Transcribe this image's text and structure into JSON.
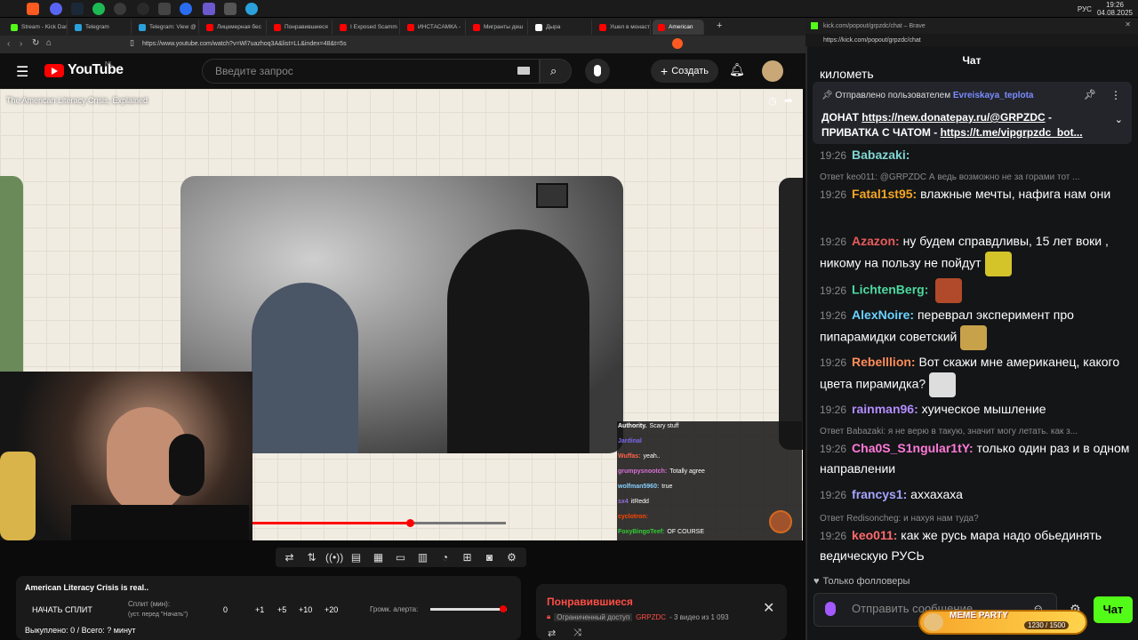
{
  "os": {
    "time": "19:26",
    "date": "04.08.2025",
    "lang": "РУС"
  },
  "browser": {
    "tabs": [
      {
        "label": "Stream - Kick Das",
        "color": "#53fc18"
      },
      {
        "label": "Telegram",
        "color": "#2aa1da"
      },
      {
        "label": "Telegram: View @",
        "color": "#2aa1da"
      },
      {
        "label": "Лицемерная бес",
        "color": "#ff0000"
      },
      {
        "label": "Понравившиеся",
        "color": "#ff0000"
      },
      {
        "label": "I Exposed Scamm",
        "color": "#ff0000"
      },
      {
        "label": "ИНСТАСАМКА -",
        "color": "#ff0000"
      },
      {
        "label": "Мигранты деш",
        "color": "#ff0000"
      },
      {
        "label": "Дыра",
        "color": "#ffffff"
      },
      {
        "label": "Ушел в монаст",
        "color": "#ff0000"
      },
      {
        "label": "American",
        "color": "#ff0000",
        "active": true
      }
    ],
    "url": "https://www.youtube.com/watch?v=Wl7uazhoq3A&list=LL&index=48&t=5s"
  },
  "youtube": {
    "logo": "YouTube",
    "region": "NL",
    "search_placeholder": "Введите запрос",
    "create_label": "Создать",
    "video_title": "The American Literacy Crisis, Explained",
    "progress": 0.62
  },
  "video_chat": [
    {
      "user": "Authority.",
      "text": "Scary stuff",
      "color": "#ffffff"
    },
    {
      "user": "Jardinal",
      "text": "",
      "color": "#7b68ee"
    },
    {
      "user": "Wuffas:",
      "text": "yeah..",
      "color": "#ff6347"
    },
    {
      "user": "grumpysnootch:",
      "text": "Totally agree",
      "color": "#da70d6"
    },
    {
      "user": "wolfman5960:",
      "text": "true",
      "color": "#87cefa"
    },
    {
      "user": "sx4",
      "text": "itRedd",
      "color": "#9370db"
    },
    {
      "user": "cyclotron:",
      "text": "",
      "color": "#ff4500"
    },
    {
      "user": "FoxyBingoTeef:",
      "text": "OF COURSE",
      "color": "#32cd32"
    }
  ],
  "split_panel": {
    "title": "American Literacy Crisis is real..",
    "start_label": "НАЧАТЬ СПЛИТ",
    "split_label": "Сплит (мин):",
    "split_hint": "(уст. перед \"Начать\")",
    "value": "0",
    "steps": [
      "+1",
      "+5",
      "+10",
      "+20"
    ],
    "alert_label": "Громк. алерта:",
    "alert_volume": 0.95,
    "totals": "Выкуплено: 0 / Всего: ? минут"
  },
  "playlist": {
    "title": "Понравившиеся",
    "access": "Ограниченный доступ",
    "owner": "GRPZDC",
    "meta": "- 3 видео из 1 093"
  },
  "kick": {
    "window_title": "kick.com/popout/grpzdc/chat – Brave",
    "url": "https://kick.com/popout/grpzdc/chat",
    "header": "Чат",
    "top_partial": "километь",
    "pinned_by_label": "Отправлено пользователем",
    "pinned_by_user": "Evreiskaya_teplota",
    "pinned_text_1": "ДОНАТ ",
    "pinned_link_1": "https://new.donatepay.ru/@GRPZDC",
    "pinned_text_2": " - ПРИВАТКА С ЧАТОМ - ",
    "pinned_link_2": "https://t.me/vipgrpzdc_bot...",
    "messages": [
      {
        "time": "19:26",
        "user": "Babazaki:",
        "color": "#7fd6d3",
        "text": " ",
        "reply": ""
      },
      {
        "time": "19:26",
        "user": "Fatal1st95:",
        "color": "#f5a623",
        "text": " влажные мечты, нафига нам они",
        "reply": "Ответ keo011: @GRPZDC А ведь возможно не за горами тот ..."
      },
      {
        "time": "19:26",
        "user": "Azazon:",
        "color": "#e85b5b",
        "text": " ну будем справдливы, 15 лет воки , никому на пользу не пойдут",
        "reply": ""
      },
      {
        "time": "19:26",
        "user": "LichtenBerg:",
        "color": "#4cd9a0",
        "text": " ",
        "reply": ""
      },
      {
        "time": "19:26",
        "user": "AlexNoire:",
        "color": "#6bd2ff",
        "text": " переврал эксперимент про пипарамидки советский",
        "reply": ""
      },
      {
        "time": "19:26",
        "user": "Rebelllion:",
        "color": "#ff8c5a",
        "text": " Вот скажи мне американец, какого цвета пирамидка?",
        "reply": ""
      },
      {
        "time": "19:26",
        "user": "rainman96:",
        "color": "#b38cff",
        "text": " хуическое мышление",
        "reply": ""
      },
      {
        "time": "19:26",
        "user": "Cha0S_S1ngular1tY:",
        "color": "#ff7ad9",
        "text": " только один раз и в одном направлении",
        "reply": "Ответ Babazaki: я не верю в такую, значит могу летать. как з..."
      },
      {
        "time": "19:26",
        "user": "francys1:",
        "color": "#a5a4ff",
        "text": " аххахаха",
        "reply": ""
      },
      {
        "time": "19:26",
        "user": "keo011:",
        "color": "#ff6b6b",
        "text": " как же русь мара надо обьединять ведическую РУСЬ",
        "reply": "Ответ Redisoncheg: и нахуя нам туда?"
      }
    ],
    "followers_only": "Только фолловеры",
    "send_placeholder": "Отправить сообщение",
    "chat_button": "Чат",
    "meme_party": "MEME PARTY",
    "meme_count": "1230 / 1500"
  }
}
